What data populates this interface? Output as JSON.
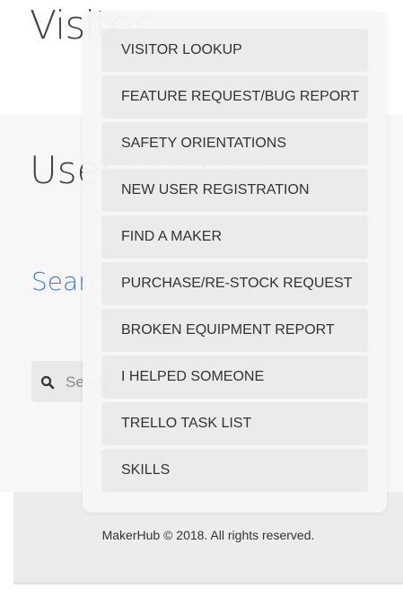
{
  "page": {
    "title": "Visitor"
  },
  "section": {
    "title": "User Search"
  },
  "search": {
    "heading": "Search",
    "placeholder": "Search",
    "icon": "search-icon"
  },
  "menu": {
    "items": [
      {
        "label": "VISITOR LOOKUP"
      },
      {
        "label": "FEATURE REQUEST/BUG REPORT"
      },
      {
        "label": "SAFETY ORIENTATIONS"
      },
      {
        "label": "NEW USER REGISTRATION"
      },
      {
        "label": "FIND A MAKER"
      },
      {
        "label": "PURCHASE/RE-STOCK REQUEST"
      },
      {
        "label": "BROKEN EQUIPMENT REPORT"
      },
      {
        "label": "I HELPED SOMEONE"
      },
      {
        "label": "TRELLO TASK LIST"
      },
      {
        "label": "SKILLS"
      }
    ]
  },
  "footer": {
    "text": "MakerHub © 2018. All rights reserved."
  },
  "colors": {
    "accent": "#3d7fd6",
    "menu_item_bg": "#ebebeb",
    "footer_bg": "#ececec"
  }
}
